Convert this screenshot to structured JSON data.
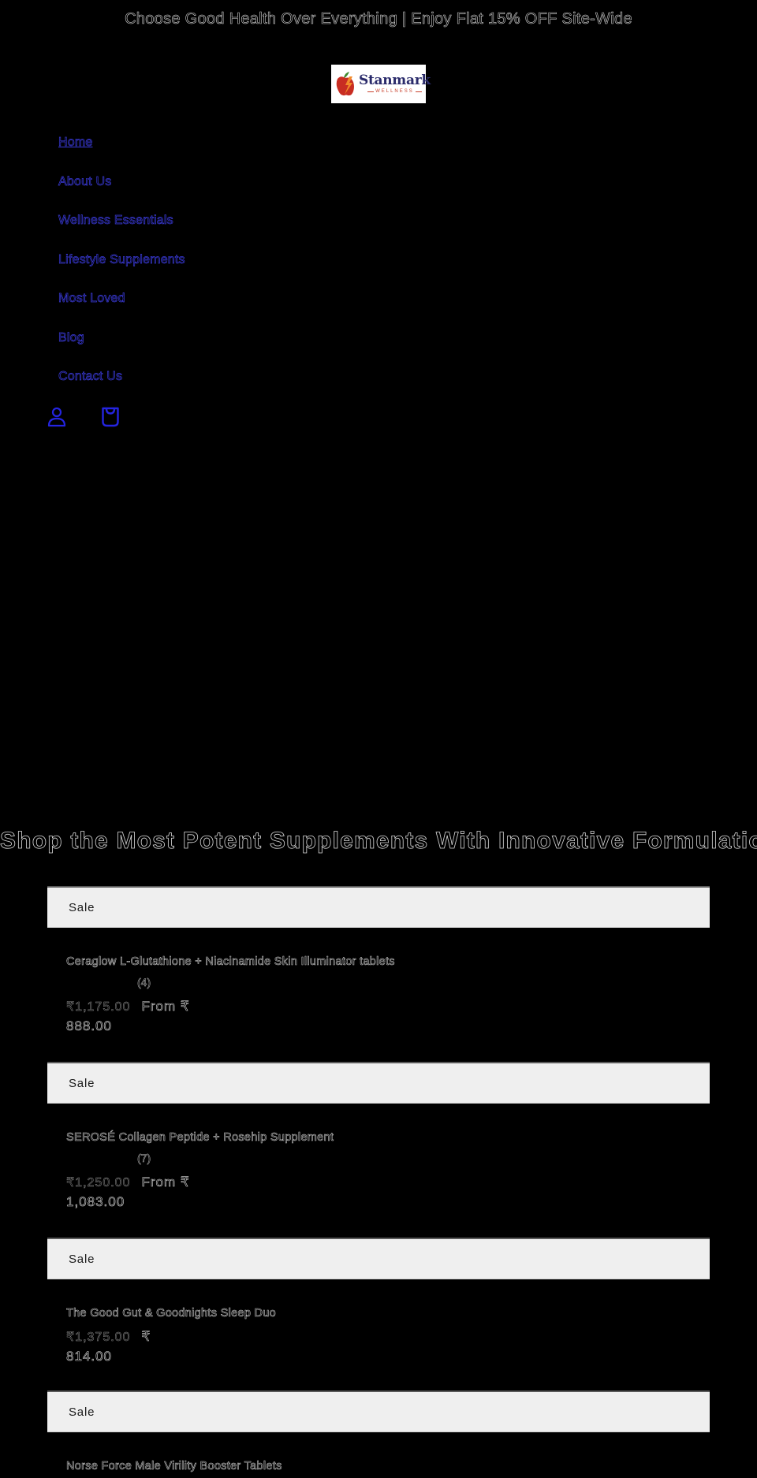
{
  "announcement": {
    "text": "Choose Good Health Over Everything | Enjoy Flat 15% OFF Site-Wide"
  },
  "logo": {
    "name": "Stanmark",
    "tagline": "WELLNESS",
    "colors": {
      "brand": "#2a2b6b",
      "accent": "#c8402c"
    }
  },
  "nav": {
    "items": [
      {
        "label": "Home",
        "active": true
      },
      {
        "label": "About Us"
      },
      {
        "label": "Wellness Essentials"
      },
      {
        "label": "Lifestyle Supplements"
      },
      {
        "label": "Most Loved"
      },
      {
        "label": "Blog"
      },
      {
        "label": "Contact Us"
      }
    ],
    "icons": {
      "account": "account-icon",
      "cart": "cart-icon"
    },
    "link_color": "#3b3bdc"
  },
  "section": {
    "heading": "Shop the Most Potent Supplements With Innovative Formulations"
  },
  "products": [
    {
      "badge": "Sale",
      "title": "Ceraglow L-Glutathione + Niacinamide Skin Illuminator tablets",
      "rating_count": "(4)",
      "regular_price": "₹1,175.00",
      "sale_prefix": "From ₹",
      "sale_price": "888.00"
    },
    {
      "badge": "Sale",
      "title": "SEROSÉ Collagen Peptide + Rosehip Supplement",
      "rating_count": "(7)",
      "regular_price": "₹1,250.00",
      "sale_prefix": "From ₹",
      "sale_price": "1,083.00"
    },
    {
      "badge": "Sale",
      "title": "The Good Gut & Goodnights Sleep Duo",
      "regular_price": "₹1,375.00",
      "sale_prefix": "₹",
      "sale_price": "814.00"
    },
    {
      "badge": "Sale",
      "title": "Norse Force Male Virility Booster Tablets"
    }
  ]
}
